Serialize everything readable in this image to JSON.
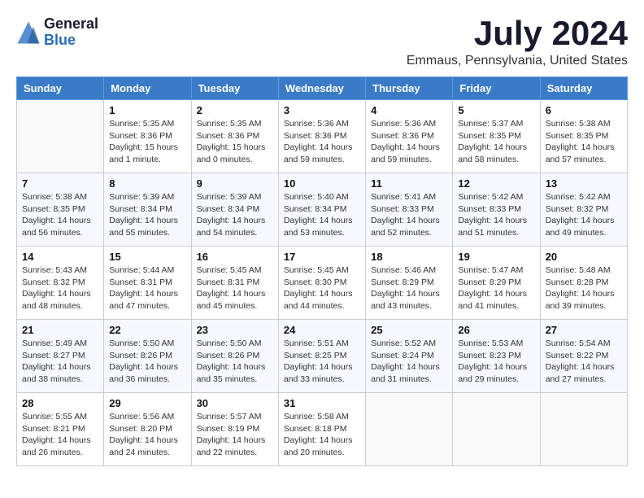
{
  "header": {
    "logo_general": "General",
    "logo_blue": "Blue",
    "month_title": "July 2024",
    "location": "Emmaus, Pennsylvania, United States"
  },
  "days_of_week": [
    "Sunday",
    "Monday",
    "Tuesday",
    "Wednesday",
    "Thursday",
    "Friday",
    "Saturday"
  ],
  "weeks": [
    [
      {
        "day": "",
        "info": ""
      },
      {
        "day": "1",
        "info": "Sunrise: 5:35 AM\nSunset: 8:36 PM\nDaylight: 15 hours\nand 1 minute."
      },
      {
        "day": "2",
        "info": "Sunrise: 5:35 AM\nSunset: 8:36 PM\nDaylight: 15 hours\nand 0 minutes."
      },
      {
        "day": "3",
        "info": "Sunrise: 5:36 AM\nSunset: 8:36 PM\nDaylight: 14 hours\nand 59 minutes."
      },
      {
        "day": "4",
        "info": "Sunrise: 5:36 AM\nSunset: 8:36 PM\nDaylight: 14 hours\nand 59 minutes."
      },
      {
        "day": "5",
        "info": "Sunrise: 5:37 AM\nSunset: 8:35 PM\nDaylight: 14 hours\nand 58 minutes."
      },
      {
        "day": "6",
        "info": "Sunrise: 5:38 AM\nSunset: 8:35 PM\nDaylight: 14 hours\nand 57 minutes."
      }
    ],
    [
      {
        "day": "7",
        "info": "Sunrise: 5:38 AM\nSunset: 8:35 PM\nDaylight: 14 hours\nand 56 minutes."
      },
      {
        "day": "8",
        "info": "Sunrise: 5:39 AM\nSunset: 8:34 PM\nDaylight: 14 hours\nand 55 minutes."
      },
      {
        "day": "9",
        "info": "Sunrise: 5:39 AM\nSunset: 8:34 PM\nDaylight: 14 hours\nand 54 minutes."
      },
      {
        "day": "10",
        "info": "Sunrise: 5:40 AM\nSunset: 8:34 PM\nDaylight: 14 hours\nand 53 minutes."
      },
      {
        "day": "11",
        "info": "Sunrise: 5:41 AM\nSunset: 8:33 PM\nDaylight: 14 hours\nand 52 minutes."
      },
      {
        "day": "12",
        "info": "Sunrise: 5:42 AM\nSunset: 8:33 PM\nDaylight: 14 hours\nand 51 minutes."
      },
      {
        "day": "13",
        "info": "Sunrise: 5:42 AM\nSunset: 8:32 PM\nDaylight: 14 hours\nand 49 minutes."
      }
    ],
    [
      {
        "day": "14",
        "info": "Sunrise: 5:43 AM\nSunset: 8:32 PM\nDaylight: 14 hours\nand 48 minutes."
      },
      {
        "day": "15",
        "info": "Sunrise: 5:44 AM\nSunset: 8:31 PM\nDaylight: 14 hours\nand 47 minutes."
      },
      {
        "day": "16",
        "info": "Sunrise: 5:45 AM\nSunset: 8:31 PM\nDaylight: 14 hours\nand 45 minutes."
      },
      {
        "day": "17",
        "info": "Sunrise: 5:45 AM\nSunset: 8:30 PM\nDaylight: 14 hours\nand 44 minutes."
      },
      {
        "day": "18",
        "info": "Sunrise: 5:46 AM\nSunset: 8:29 PM\nDaylight: 14 hours\nand 43 minutes."
      },
      {
        "day": "19",
        "info": "Sunrise: 5:47 AM\nSunset: 8:29 PM\nDaylight: 14 hours\nand 41 minutes."
      },
      {
        "day": "20",
        "info": "Sunrise: 5:48 AM\nSunset: 8:28 PM\nDaylight: 14 hours\nand 39 minutes."
      }
    ],
    [
      {
        "day": "21",
        "info": "Sunrise: 5:49 AM\nSunset: 8:27 PM\nDaylight: 14 hours\nand 38 minutes."
      },
      {
        "day": "22",
        "info": "Sunrise: 5:50 AM\nSunset: 8:26 PM\nDaylight: 14 hours\nand 36 minutes."
      },
      {
        "day": "23",
        "info": "Sunrise: 5:50 AM\nSunset: 8:26 PM\nDaylight: 14 hours\nand 35 minutes."
      },
      {
        "day": "24",
        "info": "Sunrise: 5:51 AM\nSunset: 8:25 PM\nDaylight: 14 hours\nand 33 minutes."
      },
      {
        "day": "25",
        "info": "Sunrise: 5:52 AM\nSunset: 8:24 PM\nDaylight: 14 hours\nand 31 minutes."
      },
      {
        "day": "26",
        "info": "Sunrise: 5:53 AM\nSunset: 8:23 PM\nDaylight: 14 hours\nand 29 minutes."
      },
      {
        "day": "27",
        "info": "Sunrise: 5:54 AM\nSunset: 8:22 PM\nDaylight: 14 hours\nand 27 minutes."
      }
    ],
    [
      {
        "day": "28",
        "info": "Sunrise: 5:55 AM\nSunset: 8:21 PM\nDaylight: 14 hours\nand 26 minutes."
      },
      {
        "day": "29",
        "info": "Sunrise: 5:56 AM\nSunset: 8:20 PM\nDaylight: 14 hours\nand 24 minutes."
      },
      {
        "day": "30",
        "info": "Sunrise: 5:57 AM\nSunset: 8:19 PM\nDaylight: 14 hours\nand 22 minutes."
      },
      {
        "day": "31",
        "info": "Sunrise: 5:58 AM\nSunset: 8:18 PM\nDaylight: 14 hours\nand 20 minutes."
      },
      {
        "day": "",
        "info": ""
      },
      {
        "day": "",
        "info": ""
      },
      {
        "day": "",
        "info": ""
      }
    ]
  ]
}
